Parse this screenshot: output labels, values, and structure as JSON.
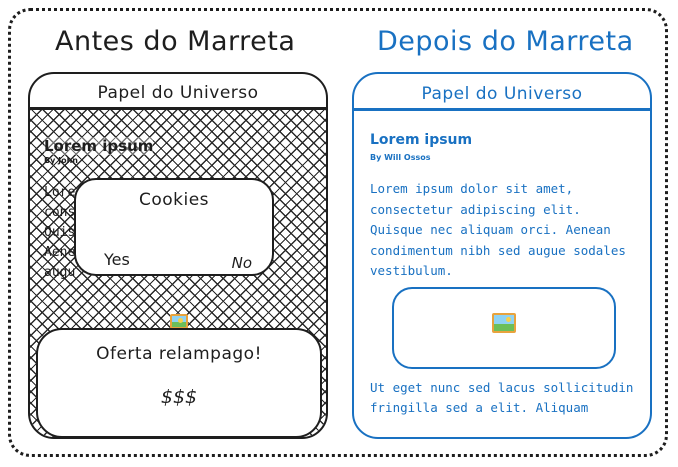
{
  "headings": {
    "before": "Antes do Marreta",
    "after": "Depois do Marreta"
  },
  "before": {
    "site_title": "Papel do Universo",
    "article_title": "Lorem ipsum",
    "author": "By John",
    "body_lines": [
      "Lore",
      "cons",
      "Quis",
      "Aene",
      "augu"
    ],
    "cookies": {
      "title": "Cookies",
      "yes": "Yes",
      "no": "No"
    },
    "offer": {
      "title": "Oferta relampago!",
      "price": "$$$"
    }
  },
  "after": {
    "site_title": "Papel do Universo",
    "article_title": "Lorem ipsum",
    "author": "By Will Ossos",
    "body": "Lorem ipsum dolor sit amet, consectetur adipiscing elit. Quisque nec aliquam orci. Aenean condimentum nibh sed augue sodales vestibulum.",
    "body_more": "Ut eget nunc sed lacus sollicitudin fringilla sed a elit. Aliquam"
  },
  "colors": {
    "before": "#1e1e1e",
    "after": "#1971c2"
  },
  "icons": [
    "picture-icon"
  ]
}
